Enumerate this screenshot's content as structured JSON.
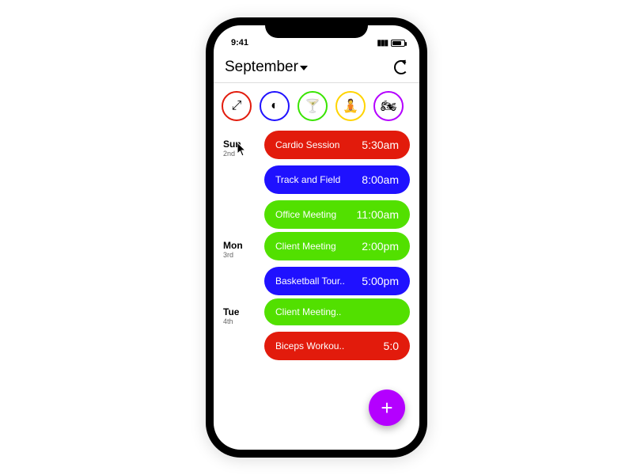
{
  "status": {
    "time": "9:41"
  },
  "header": {
    "month": "September"
  },
  "categories": [
    {
      "name": "cardio",
      "border": "#e21b0c",
      "glyph": "⤢"
    },
    {
      "name": "sports",
      "border": "#1f11ff",
      "glyph": "◐"
    },
    {
      "name": "social",
      "border": "#39e400",
      "glyph": "🍸"
    },
    {
      "name": "yoga",
      "border": "#ffd400",
      "glyph": "🧘"
    },
    {
      "name": "cycle",
      "border": "#b400ff",
      "glyph": "🏍"
    }
  ],
  "days": [
    {
      "name": "Sun",
      "num": "2nd",
      "events": [
        {
          "title": "Cardio Session",
          "time": "5:30am",
          "bg": "#e21b0c"
        },
        {
          "title": "Track and Field",
          "time": "8:00am",
          "bg": "#1f11ff"
        },
        {
          "title": "Office Meeting",
          "time": "11:00am",
          "bg": "#52e000"
        }
      ]
    },
    {
      "name": "Mon",
      "num": "3rd",
      "events": [
        {
          "title": "Client Meeting",
          "time": "2:00pm",
          "bg": "#52e000"
        },
        {
          "title": "Basketball Tour..",
          "time": "5:00pm",
          "bg": "#1f11ff"
        }
      ]
    },
    {
      "name": "Tue",
      "num": "4th",
      "events": [
        {
          "title": "Client Meeting..",
          "time": "",
          "bg": "#52e000"
        },
        {
          "title": "Biceps Workou..",
          "time": "5:0",
          "bg": "#e21b0c"
        }
      ]
    }
  ],
  "fab": {
    "label": "+"
  }
}
